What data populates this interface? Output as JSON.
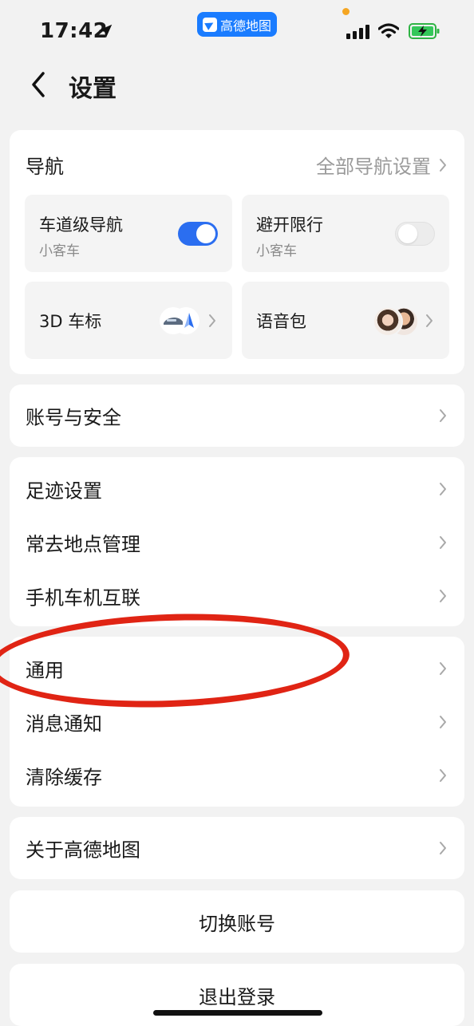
{
  "status_bar": {
    "time": "17:42",
    "app_pill": "高德地图"
  },
  "header": {
    "title": "设置"
  },
  "navigation": {
    "section_label": "导航",
    "all_settings_link": "全部导航设置",
    "tiles": {
      "lane_nav": {
        "label": "车道级导航",
        "sub": "小客车",
        "toggle_on": true
      },
      "avoid_limit": {
        "label": "避开限行",
        "sub": "小客车",
        "toggle_on": false
      },
      "car_icon_3d": {
        "label": "3D 车标"
      },
      "voice_pack": {
        "label": "语音包"
      }
    }
  },
  "account_section": {
    "account_security": "账号与安全"
  },
  "records_section": {
    "footprint": "足迹设置",
    "frequent_places": "常去地点管理",
    "phone_car_link": "手机车机互联"
  },
  "general_section": {
    "general": "通用",
    "notifications": "消息通知",
    "clear_cache": "清除缓存"
  },
  "about_section": {
    "about": "关于高德地图"
  },
  "actions": {
    "switch_account": "切换账号",
    "logout": "退出登录"
  },
  "colors": {
    "accent": "#2b6ef0",
    "annotation": "#e02414",
    "page_bg": "#f2f2f2"
  }
}
